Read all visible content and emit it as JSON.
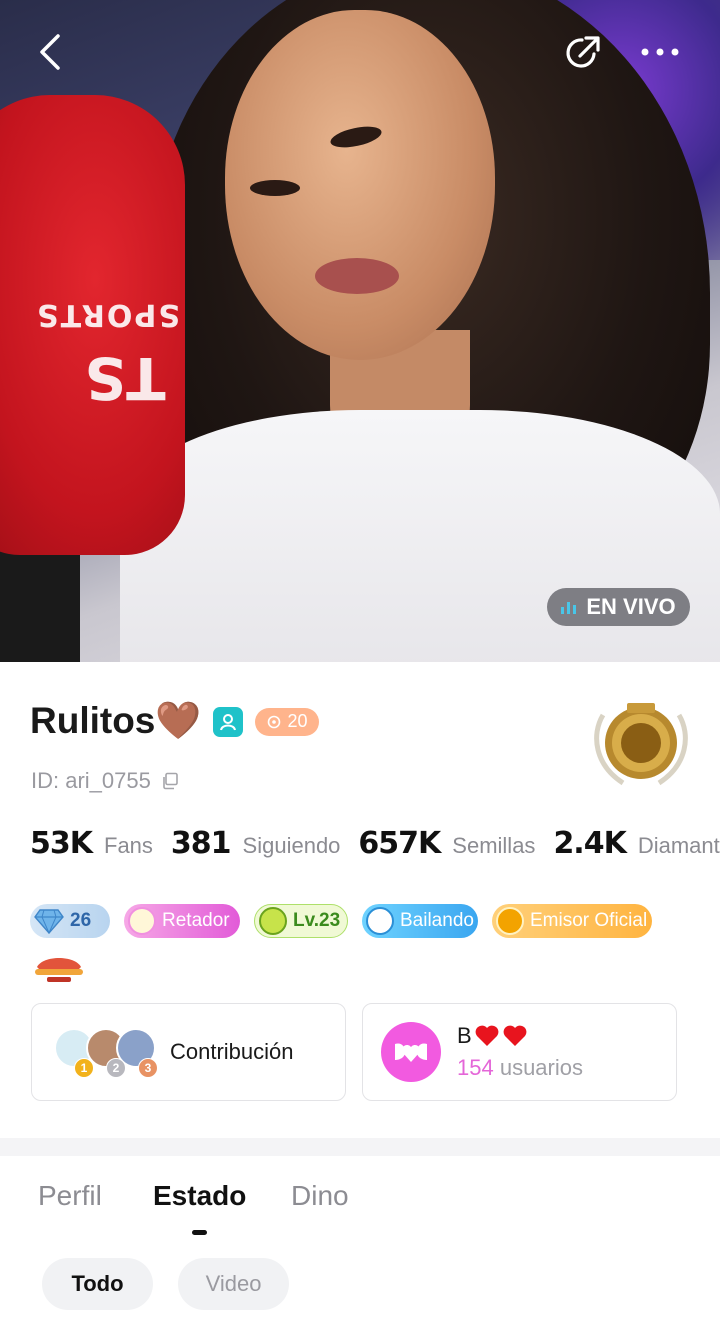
{
  "header": {
    "back_icon": "chevron-left-icon",
    "share_icon": "share-arrow-icon",
    "more_icon": "more-dots-icon",
    "live_badge": "EN VIVO"
  },
  "profile": {
    "name": "Rulitos🤎",
    "id_text": "ID: ari_0755",
    "level_badge": "20",
    "stats": [
      {
        "value": "53K",
        "label": "Fans"
      },
      {
        "value": "381",
        "label": "Siguiendo"
      },
      {
        "value": "657K",
        "label": "Semillas"
      },
      {
        "value": "2.4K",
        "label": "Diamantes"
      }
    ],
    "badges": {
      "diamond": "26",
      "retador": "Retador",
      "lv": "Lv.23",
      "bailando": "Bailando",
      "emisor": "Emisor Oficial"
    }
  },
  "cards": {
    "contrib_label": "Contribución",
    "ranks": [
      "1",
      "2",
      "3"
    ],
    "fan_title": "B",
    "fan_count": "154",
    "fan_suffix": " usuarios"
  },
  "tabs": {
    "perfil": "Perfil",
    "estado": "Estado",
    "dino": "Dino"
  },
  "filters": {
    "todo": "Todo",
    "video": "Video"
  },
  "colors": {
    "live_bar": "#49c6e8",
    "fan_pink": "#f25ae0",
    "teal": "#1fc2c9"
  }
}
